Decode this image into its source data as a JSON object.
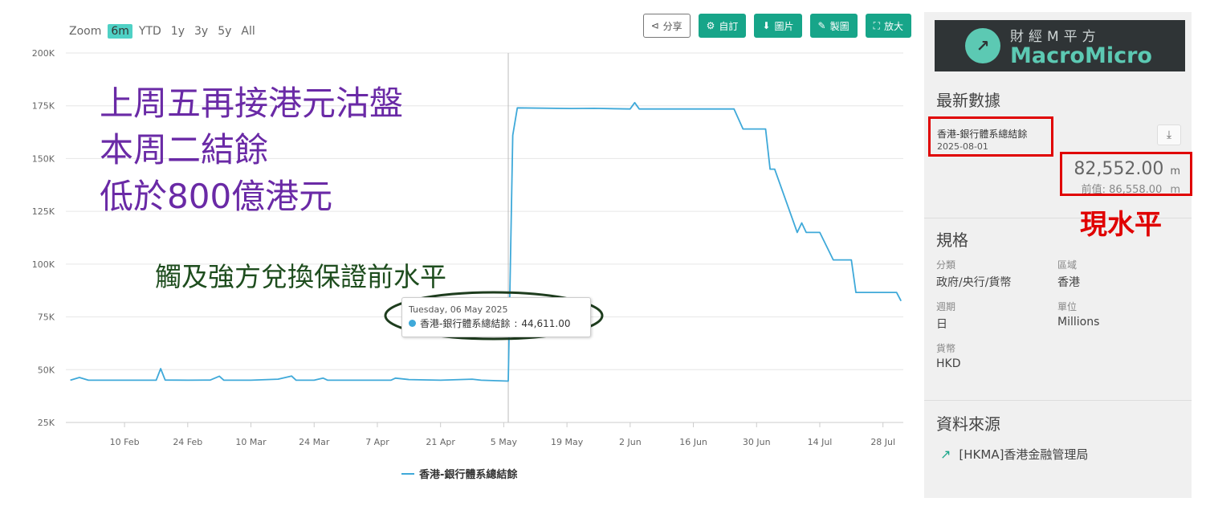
{
  "zoom": {
    "label": "Zoom",
    "options": [
      "6m",
      "YTD",
      "1y",
      "3y",
      "5y",
      "All"
    ],
    "active": "6m"
  },
  "toolbar": {
    "share_label": "分享",
    "custom_label": "自訂",
    "image_label": "圖片",
    "draw_label": "製圖",
    "expand_label": "放大"
  },
  "annotations": {
    "line1": "上周五再接港元沽盤",
    "line2": "本周二結餘",
    "line3": "低於800億港元",
    "green": "觸及強方兌換保證前水平",
    "current_level": "現水平"
  },
  "tooltip": {
    "date": "Tuesday, 06 May 2025",
    "series": "香港-銀行體系總結餘",
    "value": "44,611.00"
  },
  "legend": {
    "series": "香港-銀行體系總結餘"
  },
  "chart_data": {
    "type": "line",
    "title": "",
    "xlabel": "",
    "ylabel": "",
    "y_ticks": [
      "25K",
      "50K",
      "75K",
      "100K",
      "125K",
      "150K",
      "175K",
      "200K"
    ],
    "x_ticks": [
      "10 Feb",
      "24 Feb",
      "10 Mar",
      "24 Mar",
      "7 Apr",
      "21 Apr",
      "5 May",
      "19 May",
      "2 Jun",
      "16 Jun",
      "30 Jun",
      "14 Jul",
      "28 Jul"
    ],
    "ylim": [
      25000,
      200000
    ],
    "x_unit": "date (2025)",
    "grid": true,
    "legend": "bottom",
    "color": "#3fa9d9",
    "series": [
      {
        "name": "香港-銀行體系總結餘",
        "points": [
          [
            "2025-01-29",
            45000
          ],
          [
            "2025-01-31",
            46300
          ],
          [
            "2025-02-02",
            45000
          ],
          [
            "2025-02-10",
            45000
          ],
          [
            "2025-02-17",
            45000
          ],
          [
            "2025-02-18",
            50500
          ],
          [
            "2025-02-19",
            45100
          ],
          [
            "2025-02-24",
            45000
          ],
          [
            "2025-03-01",
            45100
          ],
          [
            "2025-03-03",
            46900
          ],
          [
            "2025-03-04",
            45000
          ],
          [
            "2025-03-10",
            45000
          ],
          [
            "2025-03-16",
            45500
          ],
          [
            "2025-03-19",
            47000
          ],
          [
            "2025-03-20",
            45000
          ],
          [
            "2025-03-24",
            45000
          ],
          [
            "2025-03-26",
            46000
          ],
          [
            "2025-03-27",
            45000
          ],
          [
            "2025-04-07",
            45000
          ],
          [
            "2025-04-10",
            45000
          ],
          [
            "2025-04-11",
            46000
          ],
          [
            "2025-04-14",
            45300
          ],
          [
            "2025-04-21",
            45000
          ],
          [
            "2025-04-28",
            45500
          ],
          [
            "2025-04-30",
            45000
          ],
          [
            "2025-05-06",
            44611
          ],
          [
            "2025-05-07",
            161000
          ],
          [
            "2025-05-08",
            174000
          ],
          [
            "2025-05-20",
            173700
          ],
          [
            "2025-05-25",
            173800
          ],
          [
            "2025-06-02",
            173500
          ],
          [
            "2025-06-03",
            176500
          ],
          [
            "2025-06-04",
            173500
          ],
          [
            "2025-06-16",
            173500
          ],
          [
            "2025-06-25",
            173500
          ],
          [
            "2025-06-27",
            164000
          ],
          [
            "2025-07-02",
            164000
          ],
          [
            "2025-07-03",
            145000
          ],
          [
            "2025-07-04",
            145000
          ],
          [
            "2025-07-09",
            115000
          ],
          [
            "2025-07-10",
            119500
          ],
          [
            "2025-07-11",
            115000
          ],
          [
            "2025-07-14",
            115000
          ],
          [
            "2025-07-17",
            102000
          ],
          [
            "2025-07-21",
            102000
          ],
          [
            "2025-07-22",
            86600
          ],
          [
            "2025-07-31",
            86600
          ],
          [
            "2025-08-01",
            82552
          ]
        ]
      }
    ]
  },
  "sidebar": {
    "logo_cn": "財經M平方",
    "logo_en": "MacroMicro",
    "latest_title": "最新數據",
    "latest_series": "香港-銀行體系總結餘",
    "latest_date": "2025-08-01",
    "latest_value": "82,552.00",
    "latest_unit": "m",
    "prev_label": "前值:",
    "prev_value": "86,558.00",
    "prev_unit": "m",
    "spec_title": "規格",
    "category_label": "分類",
    "category_value": "政府/央行/貨幣",
    "region_label": "區域",
    "region_value": "香港",
    "period_label": "週期",
    "period_value": "日",
    "unit_label": "單位",
    "unit_value": "Millions",
    "currency_label": "貨幣",
    "currency_value": "HKD",
    "source_title": "資料來源",
    "source_link": "[HKMA]香港金融管理局"
  }
}
